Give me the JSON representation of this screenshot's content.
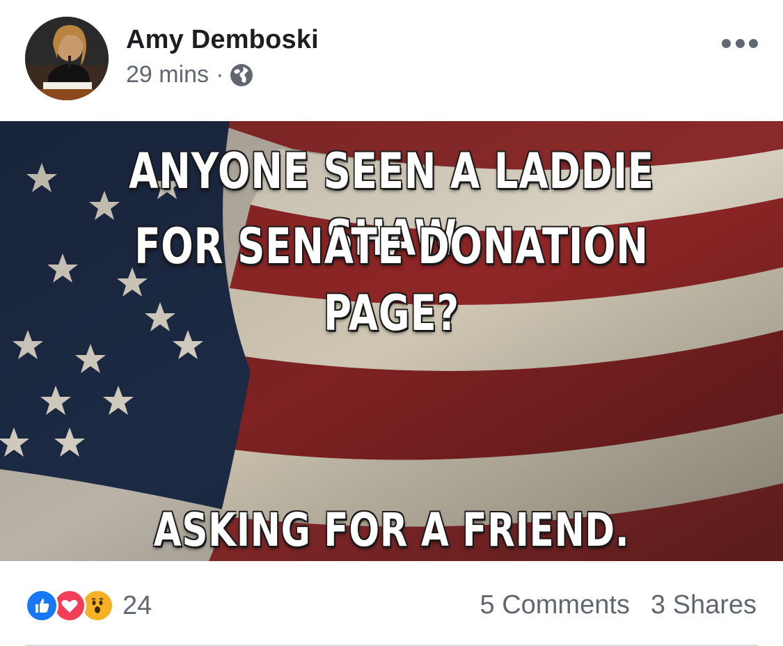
{
  "post": {
    "author": "Amy Demboski",
    "time": "29 mins",
    "separator": "·",
    "privacy_icon": "globe-icon",
    "more_icon": "more-options-icon"
  },
  "image": {
    "line1": "ANYONE SEEN A LADDIE SHAW",
    "line2": "FOR SENATE DONATION PAGE?",
    "bottom": "ASKING FOR A FRIEND."
  },
  "footer": {
    "reactions": [
      "like-icon",
      "love-icon",
      "wow-icon"
    ],
    "reaction_count": "24",
    "comments": "5 Comments",
    "shares": "3 Shares"
  },
  "colors": {
    "like": "#1877f2",
    "love": "#f33e58",
    "wow": "#f7b125",
    "secondary_text": "#606770"
  }
}
